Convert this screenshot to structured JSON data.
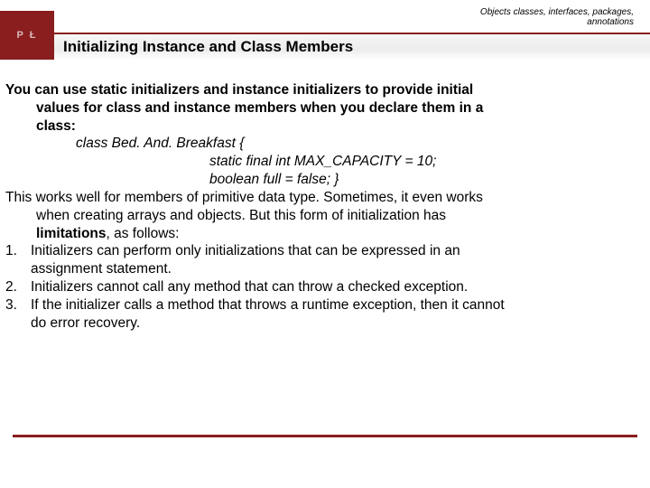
{
  "header": {
    "topic_line1": "Objects classes, interfaces, packages,",
    "topic_line2": "annotations",
    "logo_text": "P  Ł",
    "title": "Initializing Instance and Class Members"
  },
  "body": {
    "intro_l1": "You can use static initializers and instance initializers to provide initial",
    "intro_l2": "values for class and instance members when you declare them in a",
    "intro_l3": "class:",
    "code_l1": "class Bed. And. Breakfast {",
    "code_l2": "static final int MAX_CAPACITY = 10;",
    "code_l3": "boolean full = false; }",
    "para2_l1": "This works well for members of primitive data type. Sometimes, it even works",
    "para2_l2": "when creating arrays and objects. But this form of initialization has",
    "para2_l3a": "limitations",
    "para2_l3b": ", as follows:",
    "item1_num": "1.",
    "item1_l1": "Initializers can perform only initializations that can be expressed in an",
    "item1_l2": "assignment statement.",
    "item2_num": "2.",
    "item2": "Initializers cannot call any method that can throw a checked exception.",
    "item3_num": "3.",
    "item3_l1": "If the initializer calls a method that throws a runtime exception, then it cannot",
    "item3_l2": "do error recovery."
  }
}
